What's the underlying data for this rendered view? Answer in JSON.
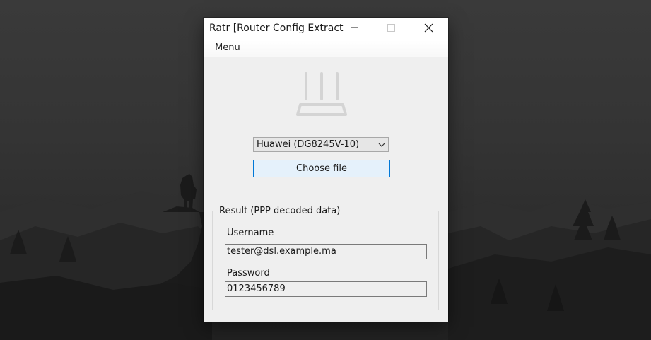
{
  "window": {
    "title": "Ratr [Router Config Extracto..."
  },
  "menubar": {
    "menu_label": "Menu"
  },
  "icons": {
    "router": "router-icon",
    "minimize": "minimize-icon",
    "maximize": "maximize-icon",
    "close": "close-icon",
    "dropdown": "chevron-down-icon"
  },
  "router_select": {
    "value": "Huawei (DG8245V-10)"
  },
  "actions": {
    "choose_file_label": "Choose file"
  },
  "result": {
    "legend": "Result (PPP decoded data)",
    "username_label": "Username",
    "username_value": "tester@dsl.example.ma",
    "password_label": "Password",
    "password_value": "0123456789"
  },
  "colors": {
    "accent": "#0078d7",
    "button_bg": "#e5f1fb",
    "window_bg": "#efefef"
  }
}
